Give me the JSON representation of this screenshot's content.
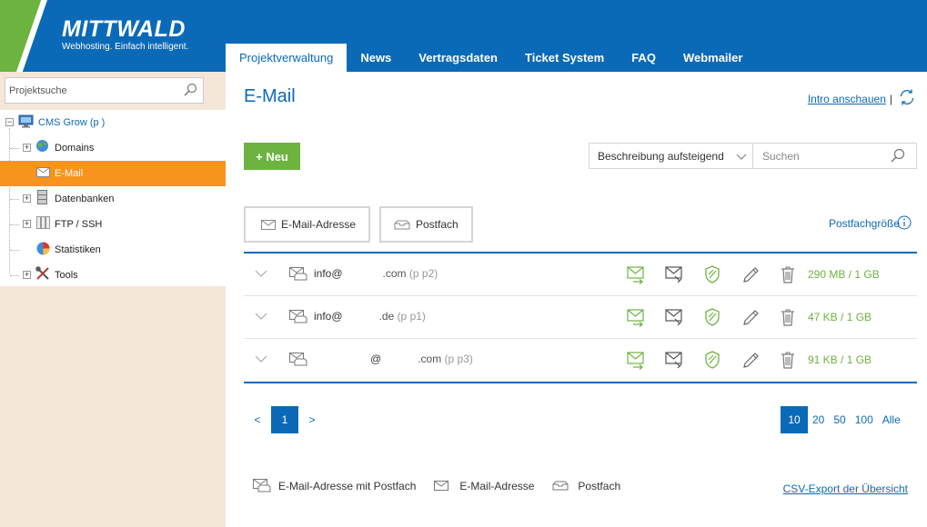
{
  "brand": {
    "name": "MITTWALD",
    "tagline": "Webhosting. Einfach intelligent.",
    "colors": {
      "primary": "#0b6ab8",
      "green": "#6db33f",
      "orange": "#f7941d",
      "sidebar_bg": "#f5e6da"
    }
  },
  "nav": {
    "tabs": [
      {
        "label": "Projektverwaltung",
        "active": true
      },
      {
        "label": "News"
      },
      {
        "label": "Vertragsdaten"
      },
      {
        "label": "Ticket System"
      },
      {
        "label": "FAQ"
      },
      {
        "label": "Webmailer"
      }
    ]
  },
  "sidebar": {
    "search_placeholder": "Projektsuche",
    "project": "CMS Grow (p          )",
    "items": [
      {
        "label": "Domains",
        "icon": "globe-icon",
        "expandable": true
      },
      {
        "label": "E-Mail",
        "icon": "envelope-icon",
        "active": true
      },
      {
        "label": "Datenbanken",
        "icon": "database-icon",
        "expandable": true
      },
      {
        "label": "FTP / SSH",
        "icon": "ftp-icon",
        "expandable": true
      },
      {
        "label": "Statistiken",
        "icon": "pie-chart-icon"
      },
      {
        "label": "Tools",
        "icon": "tools-icon",
        "expandable": true
      }
    ]
  },
  "main": {
    "title": "E-Mail",
    "intro_link": "Intro anschauen",
    "intro_separator": "|",
    "new_button": "+ Neu",
    "sort_value": "Beschreibung aufsteigend",
    "search_placeholder": "Suchen",
    "filters": {
      "email": "E-Mail-Adresse",
      "mailbox": "Postfach"
    },
    "size_header": "Postfachgröße",
    "rows": [
      {
        "local": "info@",
        "domain": ".com",
        "paren": "(p             p2)",
        "size": "290 MB / 1 GB"
      },
      {
        "local": "info@",
        "domain": ".de",
        "paren": "(p             p1)",
        "size": "47 KB / 1 GB"
      },
      {
        "local": "@",
        "domain": ".com",
        "paren": "(p             p3)",
        "size": "91 KB / 1 GB"
      }
    ],
    "pager": {
      "prev": "<",
      "next": ">",
      "current": "1"
    },
    "per_page": [
      "10",
      "20",
      "50",
      "100",
      "Alle"
    ],
    "legend": {
      "combined": "E-Mail-Adresse mit Postfach",
      "email": "E-Mail-Adresse",
      "mailbox": "Postfach"
    },
    "csv_export": "CSV-Export der Übersicht"
  }
}
